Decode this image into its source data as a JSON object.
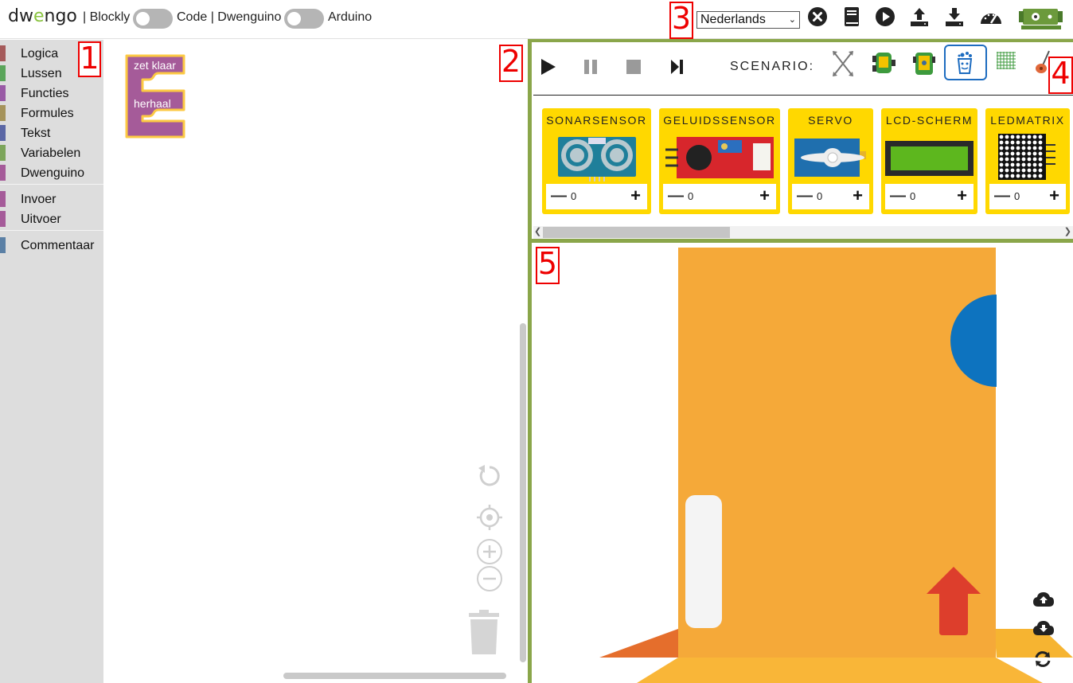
{
  "header": {
    "logo_prefix": "dw",
    "logo_e": "e",
    "logo_suffix": "ngo",
    "mode_blockly": "| Blockly",
    "mode_code": "Code | Dwenguino",
    "mode_arduino": "Arduino",
    "language": "Nederlands",
    "icons": [
      "close-circle-icon",
      "book-icon",
      "play-circle-icon",
      "upload-icon",
      "download-icon",
      "dashboard-icon",
      "robot-board-icon"
    ]
  },
  "annotations": [
    "1",
    "2",
    "3",
    "4",
    "5"
  ],
  "toolbox": {
    "categories": [
      {
        "label": "Logica",
        "color": "#a55b5b"
      },
      {
        "label": "Lussen",
        "color": "#5ba55b"
      },
      {
        "label": "Functies",
        "color": "#995ba5"
      },
      {
        "label": "Formules",
        "color": "#a5935b"
      },
      {
        "label": "Tekst",
        "color": "#5b67a5"
      },
      {
        "label": "Variabelen",
        "color": "#7da55b"
      },
      {
        "label": "Dwenguino",
        "color": "#a55b99"
      },
      {
        "label": "Invoer",
        "color": "#a55b99"
      },
      {
        "label": "Uitvoer",
        "color": "#a55b99"
      },
      {
        "label": "Commentaar",
        "color": "#5b80a5"
      }
    ]
  },
  "workspace": {
    "block_setup": "zet klaar",
    "block_loop": "herhaal",
    "block_color": "#a55b99",
    "block_outline": "#fcc943"
  },
  "simulator": {
    "controls": [
      "play-icon",
      "pause-icon",
      "stop-icon",
      "step-icon"
    ],
    "scenario_label": "SCENARIO:",
    "scenarios": [
      "arrows-scenario-icon",
      "robot-scenario-icon",
      "robot-board-scenario-icon",
      "social-robot-scenario-icon",
      "grid-scenario-icon",
      "guitar-scenario-icon"
    ],
    "selected_scenario": "social-robot-scenario-icon",
    "sensors": [
      {
        "name": "SONARSENSOR",
        "count": "0"
      },
      {
        "name": "GELUIDSSENSOR",
        "count": "0"
      },
      {
        "name": "SERVO",
        "count": "0"
      },
      {
        "name": "LCD-SCHERM",
        "count": "0"
      },
      {
        "name": "LEDMATRIX",
        "count": "0"
      }
    ],
    "scene_icons": [
      "cloud-upload-icon",
      "cloud-download-icon",
      "refresh-icon"
    ]
  },
  "colors": {
    "accent_green": "#8aa64a",
    "sensor_yellow": "#ffd800",
    "robot_orange": "#f5a939",
    "robot_blue": "#0d73bf",
    "arrow_red": "#dd3e2c"
  }
}
